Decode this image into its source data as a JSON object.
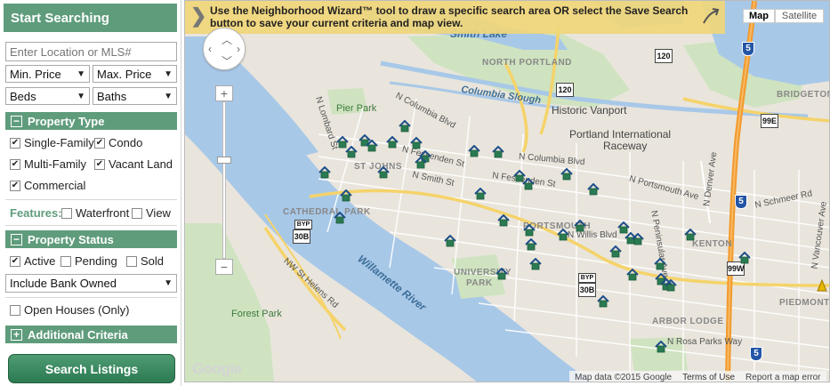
{
  "sidebar": {
    "title": "Start Searching",
    "location_placeholder": "Enter Location or MLS#",
    "min_price": "Min. Price",
    "max_price": "Max. Price",
    "beds": "Beds",
    "baths": "Baths",
    "property_type": {
      "title": "Property Type",
      "toggle": "−",
      "options": [
        {
          "label": "Single-Family",
          "checked": true
        },
        {
          "label": "Condo",
          "checked": true
        },
        {
          "label": "Multi-Family",
          "checked": true
        },
        {
          "label": "Vacant Land",
          "checked": true
        },
        {
          "label": "Commercial",
          "checked": true
        }
      ]
    },
    "features": {
      "label": "Features:",
      "options": [
        {
          "label": "Waterfront",
          "checked": false
        },
        {
          "label": "View",
          "checked": false
        }
      ]
    },
    "property_status": {
      "title": "Property Status",
      "toggle": "−",
      "options": [
        {
          "label": "Active",
          "checked": true
        },
        {
          "label": "Pending",
          "checked": false
        },
        {
          "label": "Sold",
          "checked": false
        }
      ],
      "bank_owned": "Include Bank Owned"
    },
    "open_houses": {
      "label": "Open Houses (Only)",
      "checked": false
    },
    "additional_criteria": {
      "title": "Additional Criteria",
      "toggle": "+"
    },
    "search_button": "Search Listings"
  },
  "map": {
    "wizard_text_line1": "Use the Neighborhood Wizard™ tool to draw a specific search area OR select the Save Search",
    "wizard_text_line2": "button to save your current criteria and map view.",
    "map_button": "Map",
    "satellite_button": "Satellite",
    "zoom_in": "+",
    "zoom_out": "−",
    "google_logo": "Google",
    "attribution": {
      "data": "Map data ©2015 Google",
      "terms": "Terms of Use",
      "report": "Report a map error"
    },
    "labels": {
      "smith_lake": "Smith Lake",
      "north_portland": "NORTH PORTLAND",
      "columbia_slough": "Columbia Slough",
      "pier_park": "Pier Park",
      "historic_vanport": "Historic Vanport",
      "portland_international_raceway": "Portland International",
      "raceway": "Raceway",
      "bridgeton": "BRIDGETON",
      "st_johns": "ST JOHNS",
      "cathedral_park": "CATHEDRAL PARK",
      "portsmouth": "PORTSMOUTH",
      "university_park": "UNIVERSITY",
      "university_park2": "PARK",
      "kenton": "KENTON",
      "arbor_lodge": "ARBOR LODGE",
      "piedmont": "PIEDMONT",
      "forest_park": "Forest Park",
      "willamette_river": "Willamette River",
      "nw_st_helens": "NW St Helens Rd",
      "n_lombard": "N Lombard St",
      "n_columbia_blvd": "N Columbia Blvd",
      "n_columbia_blvd2": "N Columbia Blvd",
      "n_fessenden": "N Fessenden St",
      "n_fessenden2": "N Fessenden St",
      "n_smith": "N Smith St",
      "n_willis": "N Willis Blvd",
      "n_schmeer": "N Schmeer Rd",
      "n_denver": "N Denver Ave",
      "n_vancouver": "N Vancouver Ave",
      "n_peninsular": "N Peninsular Ave",
      "n_portsmouth": "N Portsmouth Ave",
      "n_rosa_parks": "N Rosa Parks Way",
      "lombard_w": "N Lombard"
    },
    "shields": {
      "r120a": "120",
      "r120b": "120",
      "r30b_a": "30B",
      "r30b_b": "30B",
      "byp_a": "BYP",
      "byp_b": "BYP",
      "r99e": "99E",
      "r99w": "99W",
      "i5a": "5",
      "i5b": "5",
      "i5c": "5"
    }
  }
}
